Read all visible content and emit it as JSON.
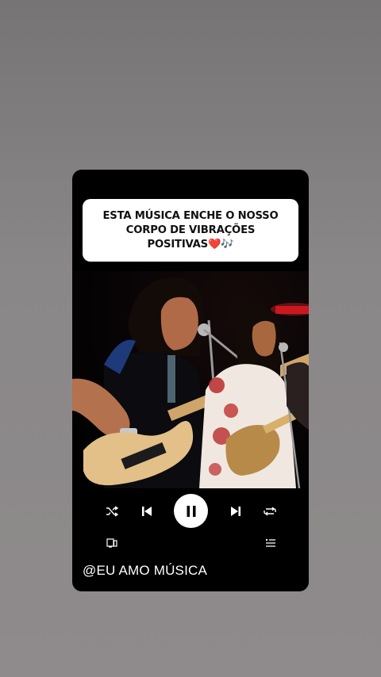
{
  "caption": {
    "line1": "ESTA MÚSICA ENCHE O NOSSO",
    "line2": "CORPO DE VIBRAÇÕES",
    "line3": "POSITIVAS",
    "emoji_heart": "❤️",
    "emoji_notes": "🎶"
  },
  "player": {
    "state": "playing",
    "controls": [
      "shuffle-icon",
      "previous-icon",
      "pause-icon",
      "next-icon",
      "repeat-icon"
    ],
    "secondary": [
      "connect-device-icon",
      "queue-icon"
    ]
  },
  "footer": {
    "handle": "@EU AMO MÚSICA"
  },
  "colors": {
    "background": "#8a8788",
    "card": "#000000",
    "caption_bg": "#ffffff",
    "heart": "#e0121b",
    "accent_text": "#ffffff"
  }
}
